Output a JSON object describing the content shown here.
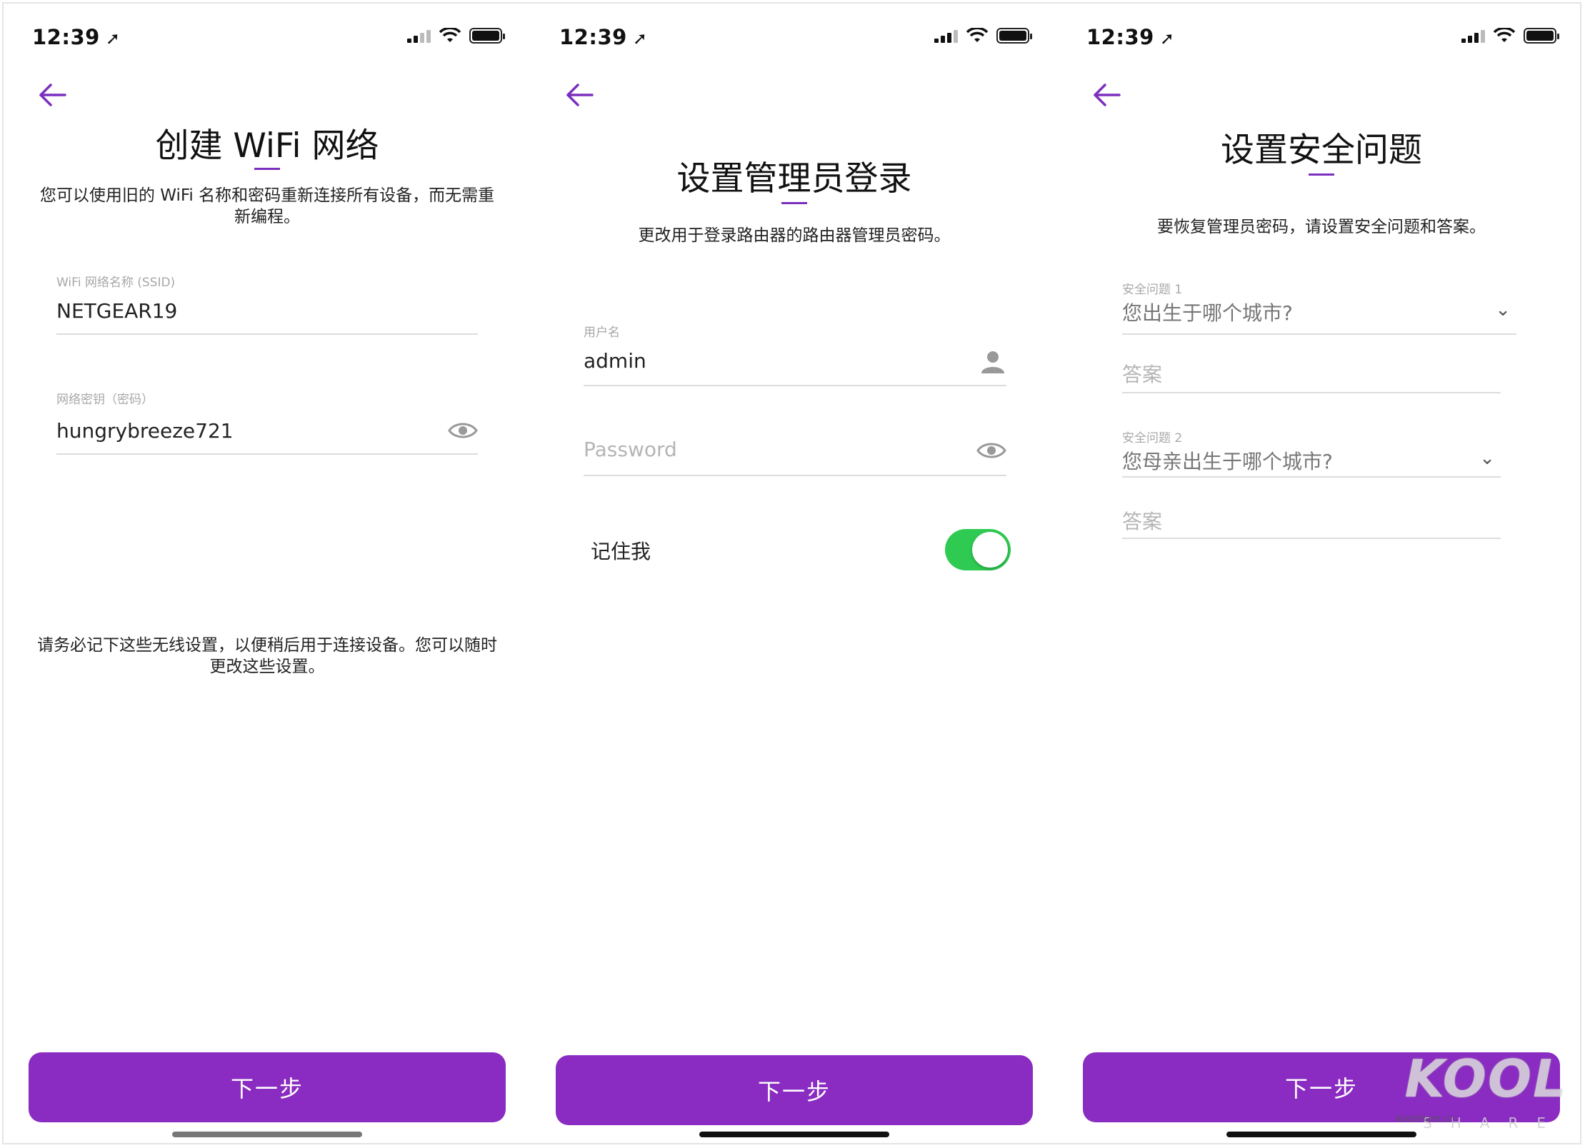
{
  "status": {
    "time": "12:39"
  },
  "screens": [
    {
      "title": "创建 WiFi 网络",
      "description": "您可以使用旧的 WiFi 名称和密码重新连接所有设备，而无需重新编程。",
      "ssid": {
        "label": "WiFi 网络名称 (SSID)",
        "value": "NETGEAR19"
      },
      "key": {
        "label": "网络密钥（密码）",
        "value": "hungrybreeze721"
      },
      "note": "请务必记下这些无线设置，以便稍后用于连接设备。您可以随时更改这些设置。",
      "next_label": "下一步"
    },
    {
      "title": "设置管理员登录",
      "description": "更改用于登录路由器的路由器管理员密码。",
      "username": {
        "label": "用户名",
        "value": "admin"
      },
      "password": {
        "placeholder": "Password"
      },
      "remember": {
        "label": "记住我",
        "on": true
      },
      "next_label": "下一步"
    },
    {
      "title": "设置安全问题",
      "description": "要恢复管理员密码，请设置安全问题和答案。",
      "q1": {
        "label": "安全问题 1",
        "value": "您出生于哪个城市?"
      },
      "a1": {
        "placeholder": "答案"
      },
      "q2": {
        "label": "安全问题 2",
        "value": "您母亲出生于哪个城市?"
      },
      "a2": {
        "placeholder": "答案"
      },
      "next_label": "下一步"
    }
  ],
  "watermark": {
    "brand": "KOOL",
    "sub": "SHARE",
    "site": "koolshare.cn"
  },
  "colors": {
    "accent": "#8a2bc2",
    "toggle_on": "#2fca52"
  }
}
